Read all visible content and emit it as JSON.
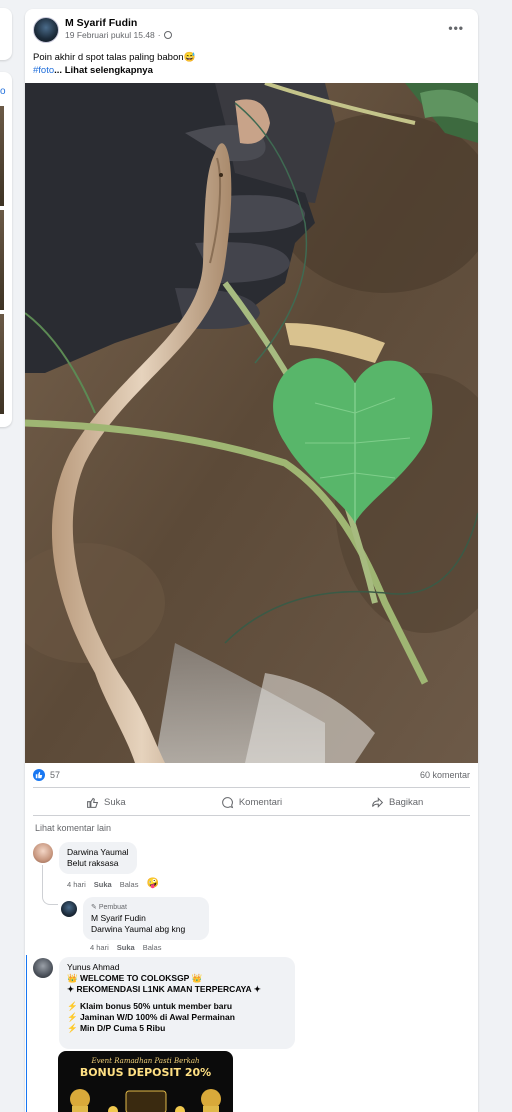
{
  "left_panel": {
    "link_fragment": "o"
  },
  "post": {
    "author": "M Syarif Fudin",
    "timestamp": "19 Februari pukul 15.48",
    "caption": "Poin akhir d spot talas paling babon😅",
    "hashtag": "#foto",
    "see_more": "... Lihat selengkapnya",
    "reactions_count": "57",
    "comments_count": "60 komentar"
  },
  "actions": {
    "like": "Suka",
    "comment": "Komentari",
    "share": "Bagikan"
  },
  "view_more_comments": "Lihat komentar lain",
  "comments": [
    {
      "name": "Darwina Yaumal",
      "text": "Belut raksasa",
      "time": "4 hari",
      "like": "Suka",
      "reply": "Balas",
      "reaction": "🤪"
    },
    {
      "badge": "Pembuat",
      "name": "M Syarif Fudin",
      "text": "Darwina Yaumal abg kng",
      "time": "4 hari",
      "like": "Suka",
      "reply": "Balas"
    },
    {
      "name": "Yunus Ahmad",
      "lines": [
        "👑 WELCOME TO COLOKSGP 👑",
        "✦ REKOMENDASI L1NK AMAN TERPERCAYA ✦",
        "",
        "⚡ Klaim bonus 50% untuk member baru",
        "⚡ Jaminan W/D 100% di Awal Permainan",
        "⚡ Min D/P Cuma 5 Ribu"
      ]
    }
  ],
  "banner": {
    "line1": "Event Ramadhan Pasti Berkah",
    "line2": "BONUS DEPOSIT 20%"
  },
  "colors": {
    "link": "#216fdb",
    "brand": "#1877f2",
    "muted": "#65676b"
  }
}
